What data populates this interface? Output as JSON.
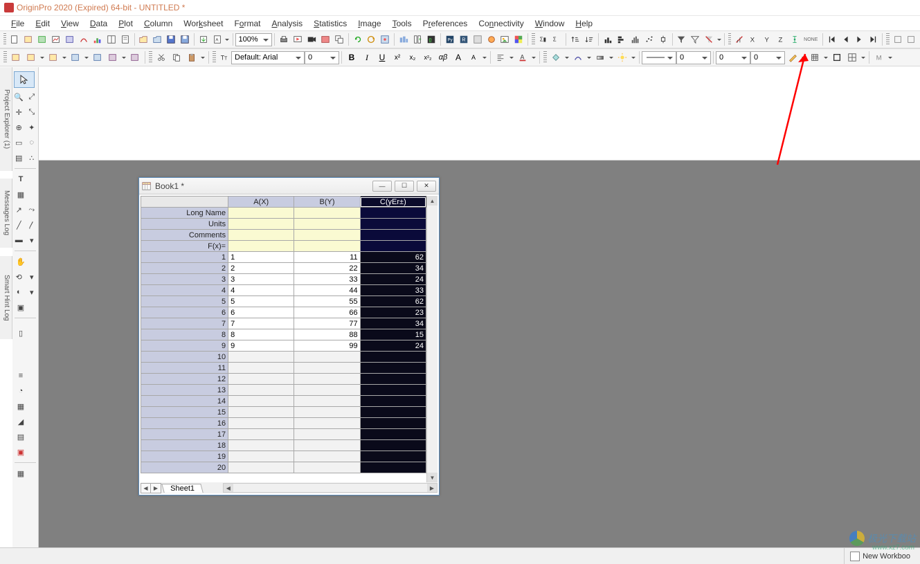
{
  "app": {
    "title": "OriginPro 2020 (Expired) 64-bit - UNTITLED *"
  },
  "menu": {
    "items": [
      "File",
      "Edit",
      "View",
      "Data",
      "Plot",
      "Column",
      "Worksheet",
      "Format",
      "Analysis",
      "Statistics",
      "Image",
      "Tools",
      "Preferences",
      "Connectivity",
      "Window",
      "Help"
    ]
  },
  "toolbar1": {
    "zoom": "100%"
  },
  "toolbar2": {
    "font_label": "Default: Arial",
    "font_size": "0",
    "line_width1": "0",
    "line_width2": "0",
    "num_val": "0"
  },
  "side_panels": {
    "project_explorer": "Project Explorer (1)",
    "messages_log": "Messages Log",
    "smart_hint": "Smart Hint Log"
  },
  "book": {
    "title": "Book1 *",
    "columns": [
      "A(X)",
      "B(Y)",
      "C(yEr±)"
    ],
    "meta_rows": [
      "Long Name",
      "Units",
      "Comments",
      "F(x)="
    ],
    "data": {
      "rownums": [
        "1",
        "2",
        "3",
        "4",
        "5",
        "6",
        "7",
        "8",
        "9",
        "10",
        "11",
        "12",
        "13",
        "14",
        "15",
        "16",
        "17",
        "18",
        "19",
        "20"
      ],
      "A": [
        "1",
        "2",
        "3",
        "4",
        "5",
        "6",
        "7",
        "8",
        "9",
        "",
        "",
        "",
        "",
        "",
        "",
        "",
        "",
        "",
        "",
        ""
      ],
      "B": [
        "11",
        "22",
        "33",
        "44",
        "55",
        "66",
        "77",
        "88",
        "99",
        "",
        "",
        "",
        "",
        "",
        "",
        "",
        "",
        "",
        "",
        ""
      ],
      "C": [
        "62",
        "34",
        "24",
        "33",
        "62",
        "23",
        "34",
        "15",
        "24",
        "",
        "",
        "",
        "",
        "",
        "",
        "",
        "",
        "",
        "",
        ""
      ]
    },
    "sheet_tab": "Sheet1"
  },
  "statusbar": {
    "label": "New Workboo"
  },
  "watermark": {
    "text": "极光下载站",
    "sub": "www.xz7.com"
  },
  "annotate": {
    "none_label": "NONE"
  }
}
